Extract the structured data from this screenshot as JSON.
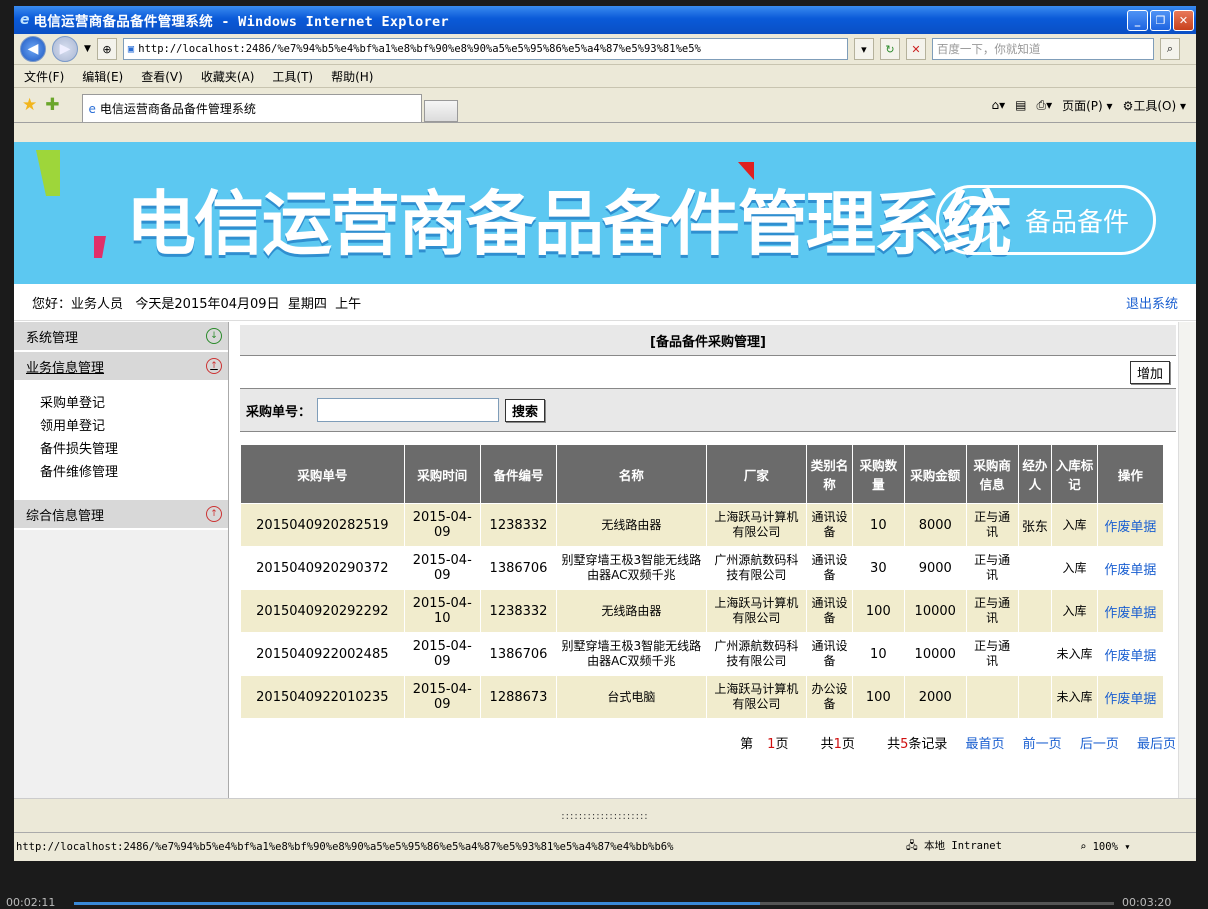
{
  "window": {
    "title": "电信运营商备品备件管理系统 - Windows Internet Explorer"
  },
  "browser": {
    "url": "http://localhost:2486/%e7%94%b5%e4%bf%a1%e8%bf%90%e8%90%a5%e5%95%86%e5%a4%87%e5%93%81%e5%",
    "search_placeholder": "百度一下，你就知道",
    "menu": [
      "文件(F)",
      "编辑(E)",
      "查看(V)",
      "收藏夹(A)",
      "工具(T)",
      "帮助(H)"
    ],
    "tab_title": "电信运营商备品备件管理系统",
    "cmd_page": "页面(P)",
    "cmd_tools": "工具(O)"
  },
  "banner": {
    "title": "电信运营商备品备件管理系统",
    "pill_text": "备品备件"
  },
  "greeting": {
    "text": "您好：业务人员   今天是2015年04月09日  星期四  上午",
    "logout": "退出系统"
  },
  "sidebar": {
    "sections": [
      {
        "label": "系统管理"
      },
      {
        "label": "业务信息管理"
      },
      {
        "label": "综合信息管理"
      }
    ],
    "items": [
      "采购单登记",
      "领用单登记",
      "备件损失管理",
      "备件维修管理"
    ]
  },
  "panel": {
    "title": "[备品备件采购管理]",
    "add_button": "增加",
    "search_label": "采购单号：",
    "search_button": "搜索"
  },
  "table": {
    "headers": [
      "采购单号",
      "采购时间",
      "备件编号",
      "名称",
      "厂家",
      "类别名称",
      "采购数量",
      "采购金额",
      "采购商信息",
      "经办人",
      "入库标记",
      "操作"
    ],
    "rows": [
      [
        "2015040920282519",
        "2015-04-09",
        "1238332",
        "无线路由器",
        "上海跃马计算机有限公司",
        "通讯设备",
        "10",
        "8000",
        "正与通讯",
        "张东",
        "入库",
        "作废单据"
      ],
      [
        "2015040920290372",
        "2015-04-09",
        "1386706",
        "别墅穿墙王极3智能无线路由器AC双频千兆",
        "广州源航数码科技有限公司",
        "通讯设备",
        "30",
        "9000",
        "正与通讯",
        "",
        "入库",
        "作废单据"
      ],
      [
        "2015040920292292",
        "2015-04-10",
        "1238332",
        "无线路由器",
        "上海跃马计算机有限公司",
        "通讯设备",
        "100",
        "10000",
        "正与通讯",
        "",
        "入库",
        "作废单据"
      ],
      [
        "2015040922002485",
        "2015-04-09",
        "1386706",
        "别墅穿墙王极3智能无线路由器AC双频千兆",
        "广州源航数码科技有限公司",
        "通讯设备",
        "10",
        "10000",
        "正与通讯",
        "",
        "未入库",
        "作废单据"
      ],
      [
        "2015040922010235",
        "2015-04-09",
        "1288673",
        "台式电脑",
        "上海跃马计算机有限公司",
        "办公设备",
        "100",
        "2000",
        "",
        "",
        "未入库",
        "作废单据"
      ]
    ]
  },
  "pager": {
    "page_prefix": "第",
    "page": "1",
    "page_suffix": "页",
    "total_prefix": "共",
    "total_pages": "1",
    "total_suffix": "页",
    "rec_prefix": "共",
    "records": "5",
    "rec_suffix": "条记录",
    "first": "最首页",
    "prev": "前一页",
    "next": "后一页",
    "last": "最后页"
  },
  "footer": {
    "dots": "::::::::::::::::::::"
  },
  "status": {
    "url": "http://localhost:2486/%e7%94%b5%e4%bf%a1%e8%bf%90%e8%90%a5%e5%95%86%e5%a4%87%e5%93%81%e5%a4%87%e4%bb%b6%",
    "zone": "本地 Intranet",
    "zoom": "100%"
  },
  "player": {
    "elapsed": "00:02:11",
    "total": "00:03:20",
    "progress": 0.66
  }
}
